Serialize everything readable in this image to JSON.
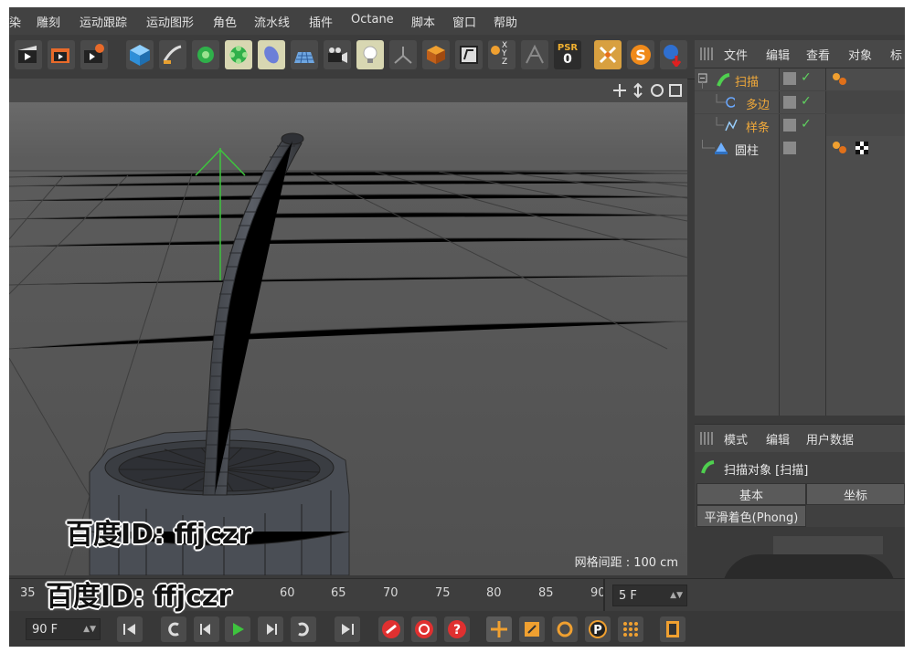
{
  "menu": [
    "染",
    "雕刻",
    "运动跟踪",
    "运动图形",
    "角色",
    "流水线",
    "插件",
    "Octane",
    "脚本",
    "窗口",
    "帮助"
  ],
  "toolbar": {
    "icons": [
      "render-view-icon",
      "render-picture-viewer-icon",
      "render-settings-icon",
      "cube-icon",
      "pen-icon",
      "subdivision-icon",
      "array-icon",
      "deformer-icon",
      "floor-icon",
      "camera-icon",
      "light-icon",
      "axis-icon",
      "coordinate-icon",
      "snap-icon",
      "xyz-icon",
      "mirror-icon",
      "psr-icon",
      "close-icon",
      "s-icon",
      "sphere-icon"
    ],
    "psr_label": "PSR",
    "psr_value": "0",
    "xyz_label": "X Y Z"
  },
  "viewport": {
    "grid_spacing": "网格间距 : 100 cm"
  },
  "object_manager": {
    "menu": [
      "文件",
      "编辑",
      "查看",
      "对象",
      "标"
    ],
    "objects": [
      {
        "name": "扫描",
        "color": "#f0a93a"
      },
      {
        "name": "多边",
        "color": "#f0a93a"
      },
      {
        "name": "样条",
        "color": "#f0a93a"
      },
      {
        "name": "圆柱",
        "color": "#e6e6e6"
      }
    ]
  },
  "attributes": {
    "menu": [
      "模式",
      "编辑",
      "用户数据"
    ],
    "object_title": "扫描对象 [扫描]",
    "tabs": [
      "基本",
      "坐标",
      "平滑着色(Phong)"
    ]
  },
  "timeline": {
    "ticks": [
      "35",
      "60",
      "65",
      "70",
      "75",
      "80",
      "85",
      "90"
    ],
    "current_frame": "5 F",
    "end_frame": "90 F"
  },
  "watermark": [
    "百度ID: ffjczr",
    "百度ID: ffjczr"
  ],
  "colors": {
    "accent": "#f0a93a",
    "check": "#5fd15f",
    "axis_green": "#3ec43e"
  }
}
